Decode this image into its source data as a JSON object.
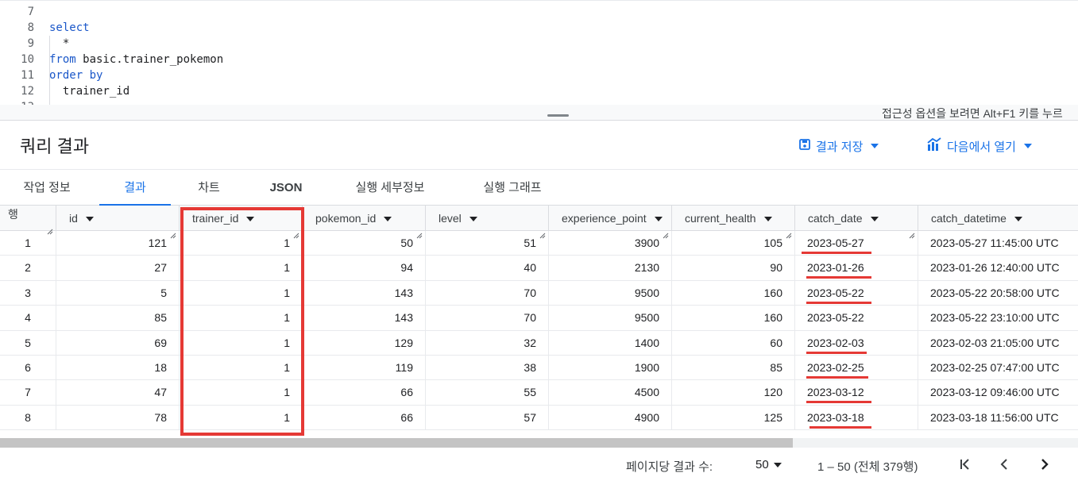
{
  "editor": {
    "lines": [
      {
        "num": "7",
        "code": ""
      },
      {
        "num": "8",
        "code": "select"
      },
      {
        "num": "9",
        "code": "  *"
      },
      {
        "num": "10",
        "code": "from basic.trainer_pokemon"
      },
      {
        "num": "11",
        "code": "order by"
      },
      {
        "num": "12",
        "code": "  trainer_id"
      },
      {
        "num": "13",
        "code": ""
      }
    ],
    "keyword_color": "#1a57c9",
    "accessibility_hint": "접근성 옵션을 보려면 Alt+F1 키를 누르"
  },
  "results": {
    "title": "쿼리 결과",
    "save_results_label": "결과 저장",
    "open_in_label": "다음에서 열기"
  },
  "tabs": [
    {
      "label": "작업 정보"
    },
    {
      "label": "결과"
    },
    {
      "label": "차트"
    },
    {
      "label": "JSON"
    },
    {
      "label": "실행 세부정보"
    },
    {
      "label": "실행 그래프"
    }
  ],
  "grid": {
    "row_header": "행",
    "columns": [
      "id",
      "trainer_id",
      "pokemon_id",
      "level",
      "experience_point",
      "current_health",
      "catch_date",
      "catch_datetime"
    ],
    "rows": [
      {
        "row": "1",
        "id": "121",
        "trainer_id": "1",
        "pokemon_id": "50",
        "level": "51",
        "experience_point": "3900",
        "current_health": "105",
        "catch_date": "2023-05-27",
        "catch_datetime": "2023-05-27 11:45:00 UTC"
      },
      {
        "row": "2",
        "id": "27",
        "trainer_id": "1",
        "pokemon_id": "94",
        "level": "40",
        "experience_point": "2130",
        "current_health": "90",
        "catch_date": "2023-01-26",
        "catch_datetime": "2023-01-26 12:40:00 UTC"
      },
      {
        "row": "3",
        "id": "5",
        "trainer_id": "1",
        "pokemon_id": "143",
        "level": "70",
        "experience_point": "9500",
        "current_health": "160",
        "catch_date": "2023-05-22",
        "catch_datetime": "2023-05-22 20:58:00 UTC"
      },
      {
        "row": "4",
        "id": "85",
        "trainer_id": "1",
        "pokemon_id": "143",
        "level": "70",
        "experience_point": "9500",
        "current_health": "160",
        "catch_date": "2023-05-22",
        "catch_datetime": "2023-05-22 23:10:00 UTC"
      },
      {
        "row": "5",
        "id": "69",
        "trainer_id": "1",
        "pokemon_id": "129",
        "level": "32",
        "experience_point": "1400",
        "current_health": "60",
        "catch_date": "2023-02-03",
        "catch_datetime": "2023-02-03 21:05:00 UTC"
      },
      {
        "row": "6",
        "id": "18",
        "trainer_id": "1",
        "pokemon_id": "119",
        "level": "38",
        "experience_point": "1900",
        "current_health": "85",
        "catch_date": "2023-02-25",
        "catch_datetime": "2023-02-25 07:47:00 UTC"
      },
      {
        "row": "7",
        "id": "47",
        "trainer_id": "1",
        "pokemon_id": "66",
        "level": "55",
        "experience_point": "4500",
        "current_health": "120",
        "catch_date": "2023-03-12",
        "catch_datetime": "2023-03-12 09:46:00 UTC"
      },
      {
        "row": "8",
        "id": "78",
        "trainer_id": "1",
        "pokemon_id": "66",
        "level": "57",
        "experience_point": "4900",
        "current_health": "125",
        "catch_date": "2023-03-18",
        "catch_datetime": "2023-03-18 11:56:00 UTC"
      }
    ],
    "underlined_catch_date_rows": [
      1,
      2,
      3,
      5,
      6,
      7,
      8
    ],
    "annotation_color": "#e53935"
  },
  "footer": {
    "page_size_label": "페이지당 결과 수:",
    "page_size_value": "50",
    "range_text": "1 – 50 (전체 379행)"
  },
  "colors": {
    "accent": "#1a73e8"
  }
}
